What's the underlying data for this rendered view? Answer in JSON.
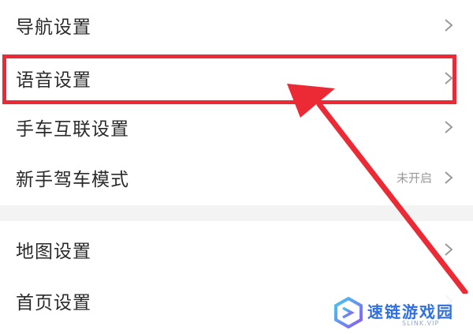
{
  "settings_groups": [
    {
      "items": [
        {
          "label": "导航设置",
          "value": ""
        },
        {
          "label": "语音设置",
          "value": ""
        },
        {
          "label": "手车互联设置",
          "value": ""
        },
        {
          "label": "新手驾车模式",
          "value": "未开启"
        }
      ]
    },
    {
      "items": [
        {
          "label": "地图设置",
          "value": ""
        },
        {
          "label": "首页设置",
          "value": ""
        }
      ]
    }
  ],
  "annotation": {
    "highlighted_item": "语音设置",
    "color": "#ec2a36"
  },
  "watermark": {
    "title": "速链游戏园",
    "subtitle": "SLINK.VIP",
    "color": "#2f6fe0"
  },
  "icons": {
    "chevron": "chevron-right-icon",
    "arrow": "annotation-arrow",
    "logo": "watermark-logo-icon"
  }
}
